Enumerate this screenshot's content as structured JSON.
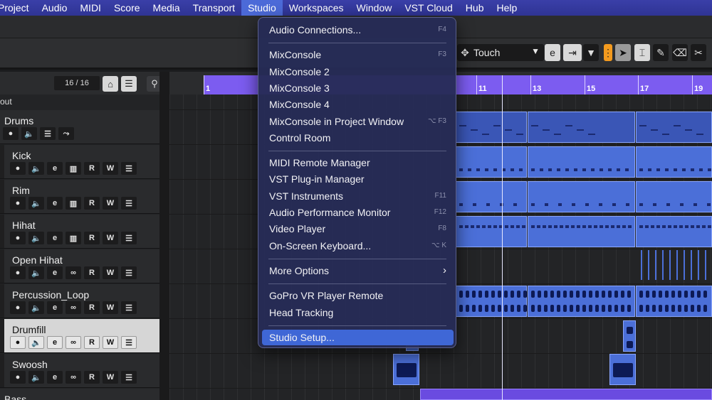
{
  "menubar": {
    "items": [
      "Project",
      "Audio",
      "MIDI",
      "Score",
      "Media",
      "Transport",
      "Studio",
      "Workspaces",
      "Window",
      "VST Cloud",
      "Hub",
      "Help"
    ],
    "active_index": 6
  },
  "toolbar": {
    "automation_mode": "Touch",
    "automation_mode_icon": "chevron-down-icon"
  },
  "tracklist": {
    "header_count": "16 / 16",
    "partial_label": "out",
    "tracks": [
      {
        "name": "Drums",
        "folder": true,
        "buttons": [
          "mute",
          "solo",
          "list",
          "folder"
        ]
      },
      {
        "name": "Kick",
        "buttons": [
          "mute",
          "solo",
          "edit",
          "piano",
          "R",
          "W",
          "list"
        ]
      },
      {
        "name": "Rim",
        "buttons": [
          "mute",
          "solo",
          "edit",
          "piano",
          "R",
          "W",
          "list"
        ]
      },
      {
        "name": "Hihat",
        "buttons": [
          "mute",
          "solo",
          "edit",
          "piano",
          "R",
          "W",
          "list"
        ]
      },
      {
        "name": "Open Hihat",
        "buttons": [
          "mute",
          "solo",
          "edit",
          "loop",
          "R",
          "W",
          "list"
        ]
      },
      {
        "name": "Percussion_Loop",
        "buttons": [
          "mute",
          "solo",
          "edit",
          "loop",
          "R",
          "W",
          "list"
        ]
      },
      {
        "name": "Drumfill",
        "selected": true,
        "buttons": [
          "mute",
          "solo",
          "edit",
          "loop",
          "R",
          "W",
          "list"
        ]
      },
      {
        "name": "Swoosh",
        "buttons": [
          "mute",
          "solo",
          "edit",
          "loop",
          "R",
          "W",
          "list"
        ]
      },
      {
        "name": "Bass",
        "folder": true,
        "buttons": []
      }
    ]
  },
  "ruler": {
    "labels": [
      "1",
      "11",
      "13",
      "15",
      "17",
      "19"
    ]
  },
  "studio_menu": {
    "items": [
      {
        "label": "Audio Connections...",
        "shortcut": "F4"
      },
      {
        "separator": true
      },
      {
        "label": "MixConsole",
        "shortcut": "F3"
      },
      {
        "label": "MixConsole 2",
        "shortcut": ""
      },
      {
        "label": "MixConsole 3",
        "shortcut": ""
      },
      {
        "label": "MixConsole 4",
        "shortcut": ""
      },
      {
        "label": "MixConsole in Project Window",
        "shortcut": "⌥ F3"
      },
      {
        "label": "Control Room",
        "shortcut": ""
      },
      {
        "separator": true
      },
      {
        "label": "MIDI Remote Manager",
        "shortcut": ""
      },
      {
        "label": "VST Plug-in Manager",
        "shortcut": ""
      },
      {
        "label": "VST Instruments",
        "shortcut": "F11"
      },
      {
        "label": "Audio Performance Monitor",
        "shortcut": "F12"
      },
      {
        "label": "Video Player",
        "shortcut": "F8"
      },
      {
        "label": "On-Screen Keyboard...",
        "shortcut": "⌥ K"
      },
      {
        "separator": true
      },
      {
        "label": "More Options",
        "submenu": true
      },
      {
        "separator": true
      },
      {
        "label": "GoPro VR Player Remote",
        "shortcut": ""
      },
      {
        "label": "Head Tracking",
        "shortcut": ""
      },
      {
        "separator": true
      },
      {
        "label": "Studio Setup...",
        "shortcut": "",
        "highlighted": true
      }
    ],
    "submenu_icon": "chevron-right-icon"
  },
  "colors": {
    "menubar": "#3a3fa8",
    "ruler": "#7c5cf0",
    "part": "#4b6fd8",
    "highlight": "#3f67d6"
  }
}
